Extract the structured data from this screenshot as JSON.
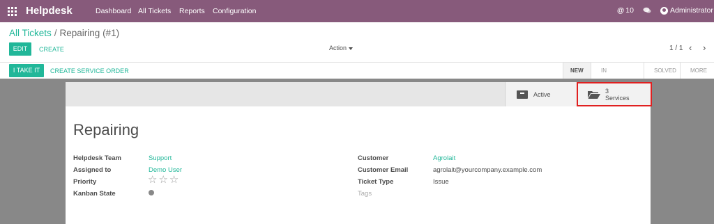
{
  "navbar": {
    "brand": "Helpdesk",
    "menu": [
      "Dashboard",
      "All Tickets",
      "Reports",
      "Configuration"
    ],
    "notifications_count": "10",
    "user_name": "Administrator"
  },
  "control_panel": {
    "breadcrumb_parent": "All Tickets",
    "breadcrumb_separator": "/",
    "breadcrumb_current": "Repairing (#1)",
    "edit_label": "EDIT",
    "create_label": "CREATE",
    "action_label": "Action",
    "pager": "1 / 1"
  },
  "statusbar": {
    "take_label": "I TAKE IT",
    "service_order_label": "CREATE SERVICE ORDER",
    "stages": [
      "NEW",
      "IN PROGRESS",
      "SOLVED",
      "MORE"
    ],
    "active_stage": "NEW"
  },
  "button_box": {
    "active_label": "Active",
    "services_count": "3",
    "services_label": "Services"
  },
  "ticket": {
    "title": "Repairing",
    "left_fields": [
      {
        "label": "Helpdesk Team",
        "value": "Support"
      },
      {
        "label": "Assigned to",
        "value": "Demo User"
      },
      {
        "label": "Priority",
        "value": ""
      },
      {
        "label": "Kanban State",
        "value": ""
      }
    ],
    "right_fields": [
      {
        "label": "Customer",
        "value": "Agrolait"
      },
      {
        "label": "Customer Email",
        "value": "agrolait@yourcompany.example.com"
      },
      {
        "label": "Ticket Type",
        "value": "Issue"
      }
    ],
    "tags_placeholder": "Tags",
    "priority_stars": "☆☆☆"
  },
  "colors": {
    "brand": "#875a7b",
    "accent": "#21b799",
    "highlight": "#e02020"
  }
}
